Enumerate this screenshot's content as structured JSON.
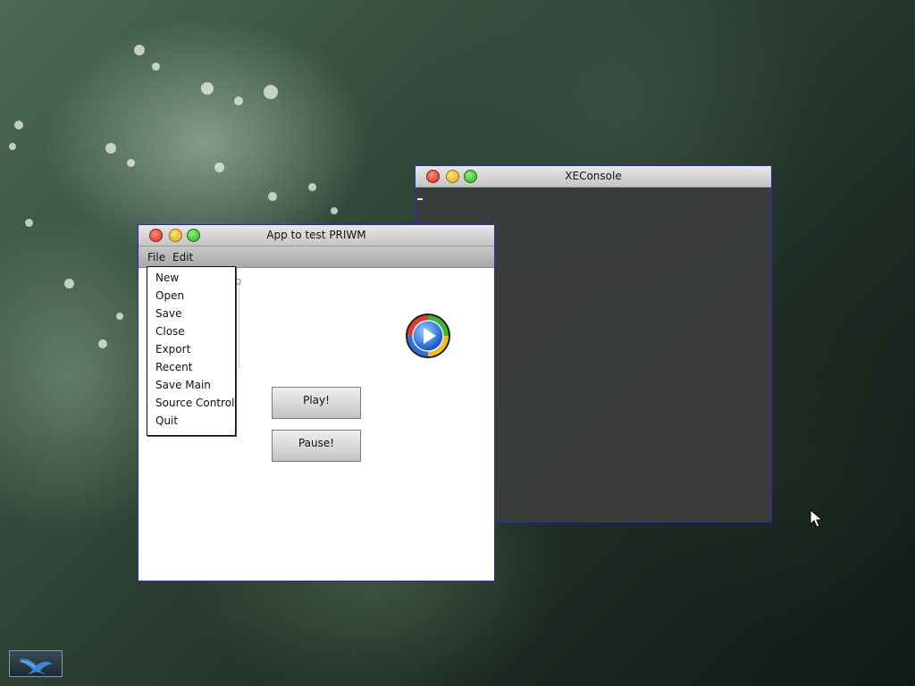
{
  "console_window": {
    "title": "XEConsole"
  },
  "app_window": {
    "title": "App to test PRIWM",
    "menubar": {
      "file": "File",
      "edit": "Edit"
    },
    "group_label": "up",
    "buttons": {
      "play": "Play!",
      "pause": "Pause!"
    }
  },
  "file_menu": {
    "items": [
      "New",
      "Open",
      "Save",
      "Close",
      "Export",
      "Recent",
      "Save Main",
      "Source Control",
      "Quit"
    ]
  },
  "icons": {
    "traffic_lights": [
      "close-icon",
      "minimize-icon",
      "maximize-icon"
    ],
    "media": "media-player-icon",
    "logo": "bird-logo-icon",
    "cursor": "mouse-pointer-icon"
  },
  "colors": {
    "window_border": "#2a2ac8",
    "close": "#d42a22",
    "minimize": "#e0a813",
    "maximize": "#29b21c"
  }
}
